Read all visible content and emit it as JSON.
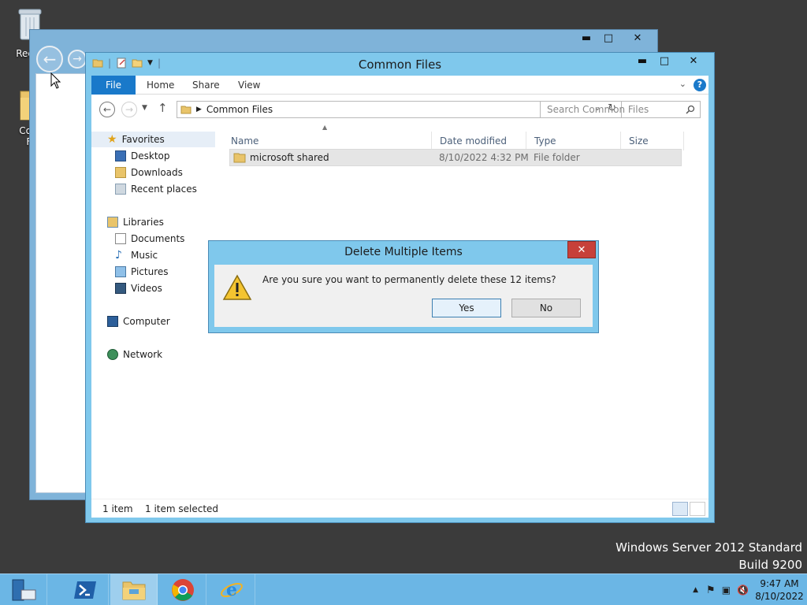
{
  "desktop": {
    "recycle_label": "Recyc",
    "folder_label_1": "Com",
    "folder_label_2": "Fi"
  },
  "watermark": {
    "line1": "Windows Server 2012 Standard",
    "line2": "Build 9200"
  },
  "window": {
    "title": "Common Files",
    "ribbon_tabs": [
      "File",
      "Home",
      "Share",
      "View"
    ],
    "address": "Common Files",
    "search_placeholder": "Search Common Files",
    "nav": {
      "favorites": "Favorites",
      "desktop": "Desktop",
      "downloads": "Downloads",
      "recent": "Recent places",
      "libraries": "Libraries",
      "documents": "Documents",
      "music": "Music",
      "pictures": "Pictures",
      "videos": "Videos",
      "computer": "Computer",
      "network": "Network"
    },
    "columns": [
      "Name",
      "Date modified",
      "Type",
      "Size"
    ],
    "rows": [
      {
        "name": "microsoft shared",
        "date": "8/10/2022 4:32 PM",
        "type": "File folder",
        "size": ""
      }
    ],
    "status_count": "1 item",
    "status_selected": "1 item selected"
  },
  "dialog": {
    "title": "Delete Multiple Items",
    "message": "Are you sure you want to permanently delete these 12 items?",
    "yes": "Yes",
    "no": "No"
  },
  "taskbar": {
    "time": "9:47 AM",
    "date": "8/10/2022"
  },
  "colors": {
    "accent": "#1979ca",
    "frame": "#7fc8ec",
    "taskbar": "#6bb6e5",
    "close": "#c7403a"
  }
}
